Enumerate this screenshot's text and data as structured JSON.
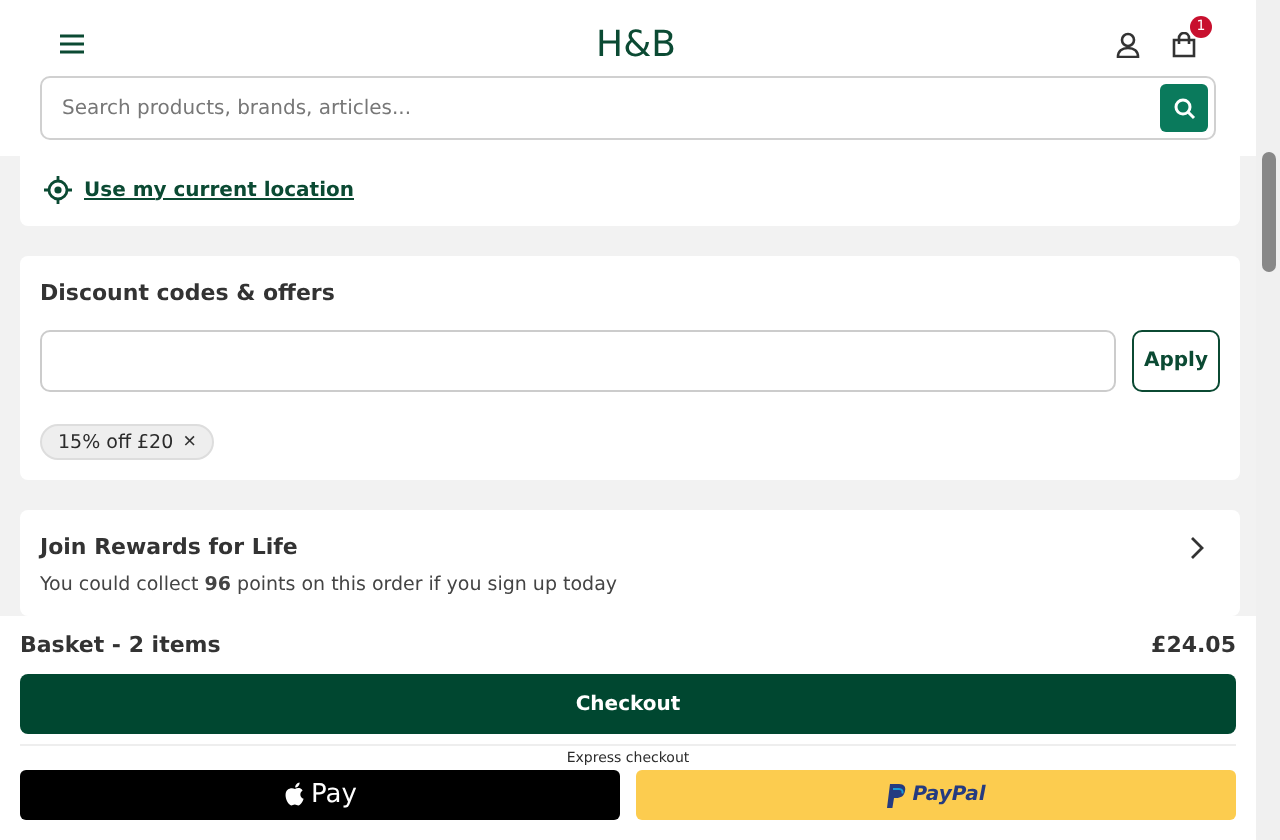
{
  "header": {
    "logo": "H&B",
    "basket_count": "1",
    "search": {
      "placeholder": "Search products, brands, articles..."
    }
  },
  "location": {
    "link": "Use my current location"
  },
  "discount": {
    "title": "Discount codes & offers",
    "button": "Apply",
    "codes": [
      {
        "label": "15% off £20",
        "remove": "×"
      }
    ]
  },
  "rewards": {
    "title": "Join Rewards for Life",
    "text": "You could collect **96** points on this order if you sign up today"
  },
  "summary": {
    "label": "Basket - 2 items",
    "total": "£24.05",
    "checkout": "Checkout",
    "express": "Express checkout",
    "apple_pay": "Pay",
    "paypal": "PayPal"
  }
}
